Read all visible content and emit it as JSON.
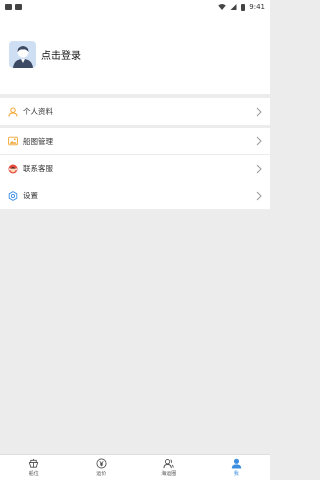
{
  "status_bar": {
    "time": "9:41"
  },
  "profile": {
    "login_text": "点击登录"
  },
  "menu": {
    "group1": [
      {
        "label": "个人资料",
        "icon": "person-icon"
      }
    ],
    "group2": [
      {
        "label": "船图管理",
        "icon": "image-icon"
      },
      {
        "label": "联系客服",
        "icon": "customer-service-icon"
      }
    ],
    "group3": [
      {
        "label": "设置",
        "icon": "settings-icon"
      }
    ]
  },
  "bottom_nav": [
    {
      "label": "船位",
      "icon": "ship-icon",
      "active": false
    },
    {
      "label": "运价",
      "icon": "yen-icon",
      "active": false
    },
    {
      "label": "海运圈",
      "icon": "group-icon",
      "active": false
    },
    {
      "label": "我",
      "icon": "user-icon",
      "active": true
    }
  ],
  "colors": {
    "accent": "#3b8de0",
    "background": "#ececec"
  }
}
